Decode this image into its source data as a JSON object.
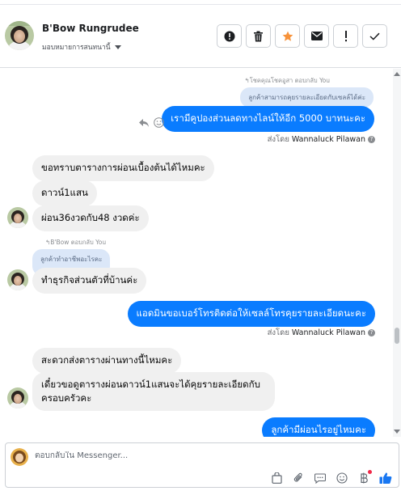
{
  "header": {
    "name": "B'Bow Rungrudee",
    "assign_label": "มอบหมายการสนทนานี้"
  },
  "messages": {
    "reply_note_1": "↰โชคคุณโชคอูสา ตอบกลับ You",
    "quote_1": "ลูกค้าสามารถคุยรายละเอียดกับเซลล์ได้ค่ะ",
    "out_1": "เรามีคูปองส่วนลดทางไลน์ให้อีก 5000 บาทนะคะ",
    "sent_by_label": "ส่งโดย",
    "sent_by_name": "Wannaluck Pilawan",
    "in_1": "ขอทราบตารางการผ่อนเบื้องต้นได้ไหมคะ",
    "in_2": "ดาวน์1แสน",
    "in_3": "ผ่อน36งวดกับ48 งวดค่ะ",
    "reply_note_2": "↰B'Bow ตอบกลับ You",
    "quote_2": "ลูกค้าทำอาชีพอะไรคะ",
    "in_4": "ทำธุรกิจส่วนตัวที่บ้านค่ะ",
    "out_2": "แอดมินขอเบอร์โทรติดต่อให้เซลล์โทรคุยรายละเอียดนะคะ",
    "in_5": "สะดวกส่งตารางผ่านทางนี้ไหมคะ",
    "in_6": "เดี๋ยวขอดูตารางผ่อนดาวน์1แสนจะได้คุยรายละเอียดกับครอบครัวคะ",
    "out_3": "ลูกค้ามีผ่อนไรอยู่ไหมคะ"
  },
  "composer": {
    "placeholder": "ตอบกลับใน Messenger..."
  },
  "colors": {
    "outgoing": "#0a7cff",
    "incoming": "#f0f0f0",
    "quote": "#dbe7f8",
    "star": "#f7923a",
    "like": "#1877f2"
  },
  "icons": [
    "alert-circle-icon",
    "trash-icon",
    "star-icon",
    "envelope-icon",
    "exclamation-icon",
    "checkmark-icon",
    "reply-arrow-icon",
    "smiley-icon",
    "info-icon",
    "bag-icon",
    "paperclip-icon",
    "chat-icon",
    "emoji-icon",
    "baht-icon",
    "thumbs-up-icon"
  ]
}
